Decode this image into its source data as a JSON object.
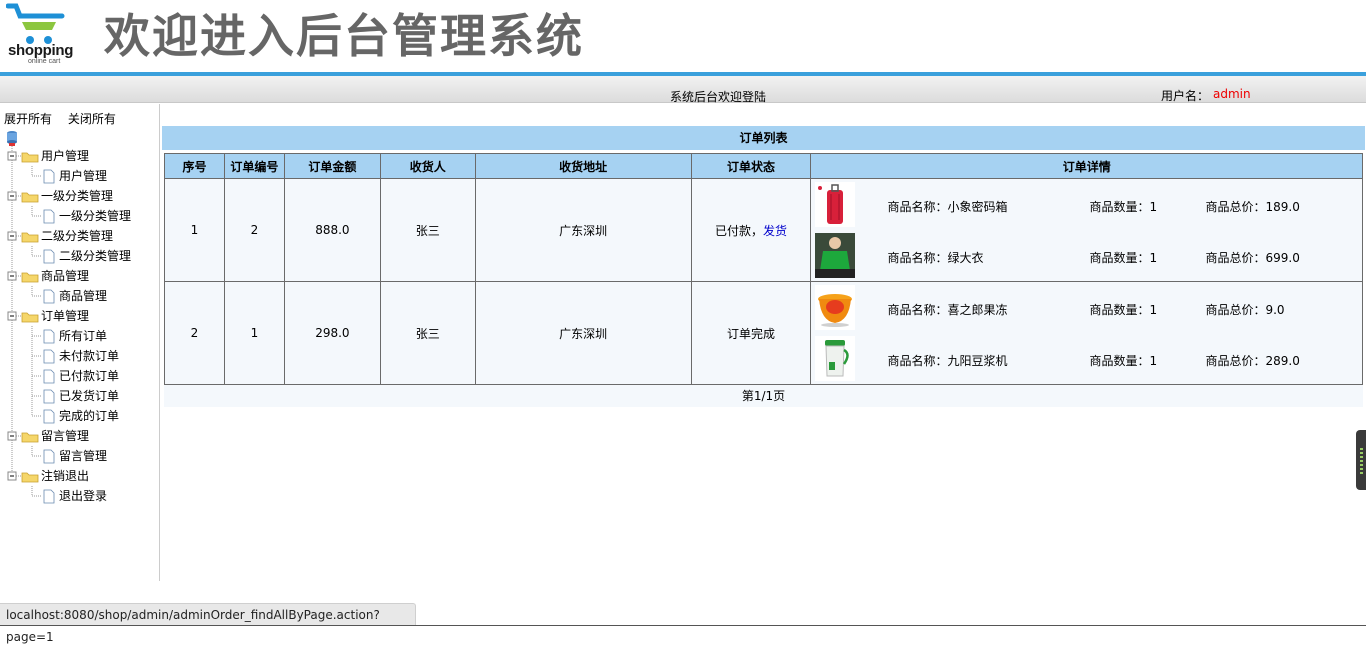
{
  "header": {
    "logo_word": "shopping",
    "logo_sub": "online cart",
    "title": "欢迎进入后台管理系统"
  },
  "welcome_bar": {
    "text": "系统后台欢迎登陆",
    "user_label": "用户名：",
    "user_name": "admin"
  },
  "sidebar": {
    "expand_all": "展开所有",
    "collapse_all": "关闭所有",
    "groups": [
      {
        "label": "用户管理",
        "items": [
          "用户管理"
        ]
      },
      {
        "label": "一级分类管理",
        "items": [
          "一级分类管理"
        ]
      },
      {
        "label": "二级分类管理",
        "items": [
          "二级分类管理"
        ]
      },
      {
        "label": "商品管理",
        "items": [
          "商品管理"
        ]
      },
      {
        "label": "订单管理",
        "items": [
          "所有订单",
          "未付款订单",
          "已付款订单",
          "已发货订单",
          "完成的订单"
        ]
      },
      {
        "label": "留言管理",
        "items": [
          "留言管理"
        ]
      },
      {
        "label": "注销退出",
        "items": [
          "退出登录"
        ]
      }
    ]
  },
  "main": {
    "list_title": "订单列表",
    "columns": [
      "序号",
      "订单编号",
      "订单金额",
      "收货人",
      "收货地址",
      "订单状态",
      "订单详情"
    ],
    "detail_labels": {
      "name": "商品名称：",
      "qty": "商品数量：",
      "total": "商品总价："
    },
    "orders": [
      {
        "seq": "1",
        "order_no": "2",
        "amount": "888.0",
        "receiver": "张三",
        "address": "广东深圳",
        "status": "已付款，",
        "action": "发货",
        "items": [
          {
            "icon": "red-suitcase-icon",
            "name": "小象密码箱",
            "qty": "1",
            "total": "189.0"
          },
          {
            "icon": "green-coat-icon",
            "name": "绿大衣",
            "qty": "1",
            "total": "699.0"
          }
        ]
      },
      {
        "seq": "2",
        "order_no": "1",
        "amount": "298.0",
        "receiver": "张三",
        "address": "广东深圳",
        "status": "订单完成",
        "action": "",
        "items": [
          {
            "icon": "jelly-icon",
            "name": "喜之郎果冻",
            "qty": "1",
            "total": "9.0"
          },
          {
            "icon": "soymilk-maker-icon",
            "name": "九阳豆浆机",
            "qty": "1",
            "total": "289.0"
          }
        ]
      }
    ],
    "pager": "第1/1页"
  },
  "status_bar": {
    "url": "localhost:8080/shop/admin/adminOrder_findAllByPage.action?page=1"
  },
  "colors": {
    "accent_blue": "#3aa0dc",
    "table_header": "#a6d2f2",
    "user_name": "#e00000",
    "link": "#0000cc"
  }
}
